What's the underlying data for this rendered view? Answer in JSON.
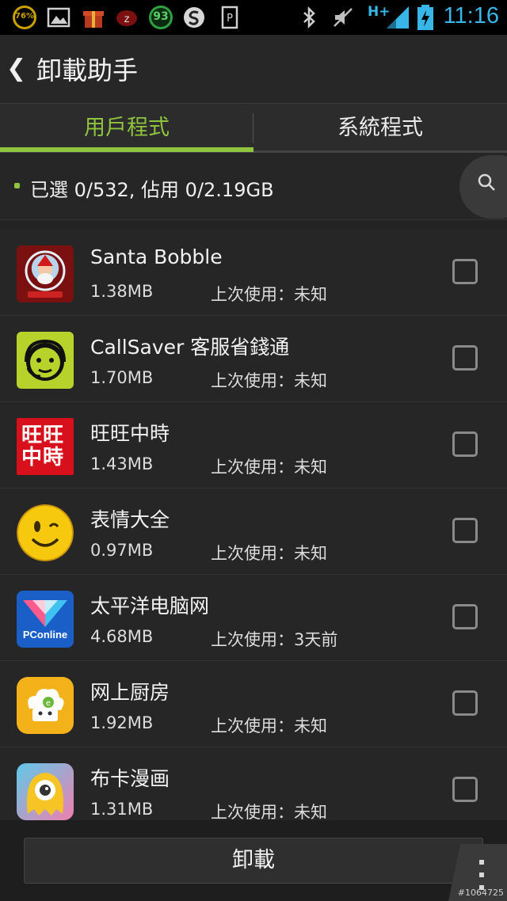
{
  "status_bar": {
    "battery_badge": "76%",
    "score_badge": "93",
    "network_label": "H+",
    "time": "11:16"
  },
  "header": {
    "title": "卸載助手"
  },
  "tabs": [
    {
      "label": "用戶程式",
      "selected": true
    },
    {
      "label": "系統程式",
      "selected": false
    }
  ],
  "summary": {
    "text": "已選 0/532, 佔用 0/2.19GB"
  },
  "apps": [
    {
      "name": "Santa Bobble",
      "size": "1.38MB",
      "last_used": "上次使用：未知",
      "icon": "santa-bobble-icon",
      "checked": false
    },
    {
      "name": "CallSaver 客服省錢通",
      "size": "1.70MB",
      "last_used": "上次使用：未知",
      "icon": "callsaver-icon",
      "checked": false
    },
    {
      "name": "旺旺中時",
      "size": "1.43MB",
      "last_used": "上次使用：未知",
      "icon": "wangwang-icon",
      "icon_text": "旺旺中時",
      "checked": false
    },
    {
      "name": "表情大全",
      "size": "0.97MB",
      "last_used": "上次使用：未知",
      "icon": "smiley-icon",
      "checked": false
    },
    {
      "name": "太平洋电脑网",
      "size": "4.68MB",
      "last_used": "上次使用：3天前",
      "icon": "pconline-icon",
      "icon_text": "PConline",
      "checked": false
    },
    {
      "name": "网上厨房",
      "size": "1.92MB",
      "last_used": "上次使用：未知",
      "icon": "kitchen-icon",
      "checked": false
    },
    {
      "name": "布卡漫画",
      "size": "1.31MB",
      "last_used": "上次使用：未知",
      "icon": "buka-icon",
      "checked": false
    }
  ],
  "footer": {
    "uninstall_label": "卸載"
  },
  "watermark": "#1064725",
  "colors": {
    "accent": "#8fc43e",
    "clock": "#38b6e8",
    "background": "#232323"
  }
}
